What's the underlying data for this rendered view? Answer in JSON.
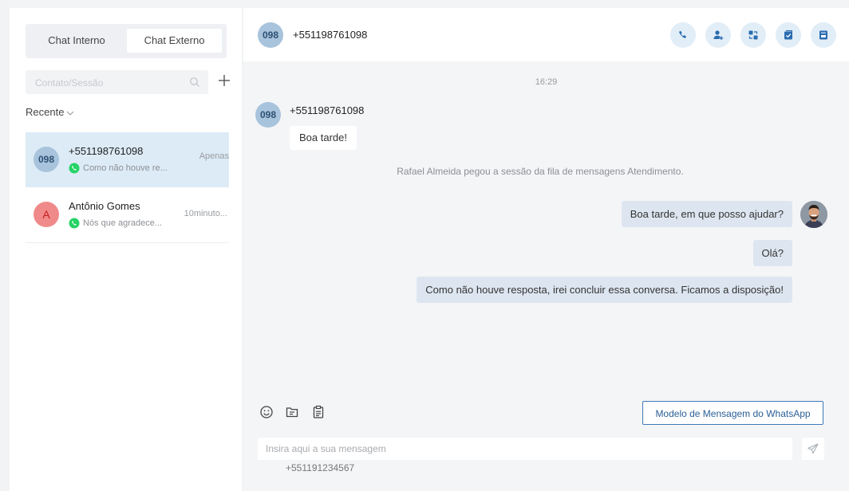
{
  "sidebar": {
    "tabs": [
      {
        "label": "Chat Interno"
      },
      {
        "label": "Chat Externo"
      }
    ],
    "search": {
      "placeholder": "Contato/Sessão"
    },
    "filter_label": "Recente",
    "conversations": [
      {
        "avatar_text": "098",
        "name": "+551198761098",
        "preview": "Como não houve re...",
        "time": "Apenas",
        "active": true
      },
      {
        "avatar_text": "A",
        "name": "Antônio Gomes",
        "preview": "Nós que agradece...",
        "time": "10minuto..."
      }
    ]
  },
  "chat": {
    "header": {
      "avatar_text": "098",
      "phone": "+551198761098"
    },
    "header_actions": [
      "phone-icon",
      "add-user-icon",
      "transfer-icon",
      "check-square-icon",
      "archive-icon"
    ],
    "timestamp": "16:29",
    "incoming": {
      "avatar_text": "098",
      "sender": "+551198761098",
      "text": "Boa tarde!"
    },
    "system_message": "Rafael Almeida pegou a sessão da fila de mensagens Atendimento.",
    "outgoing": [
      "Boa tarde, em que posso ajudar?",
      "Olá?",
      "Como não houve resposta, irei concluir essa conversa. Ficamos a disposição!"
    ],
    "toolbar": {
      "icons": [
        "emoji-icon",
        "folder-icon",
        "clipboard-icon"
      ],
      "template_button": "Modelo de Mensagem do WhatsApp"
    },
    "composer": {
      "placeholder": "Insira aqui a sua mensagem",
      "value": ""
    },
    "caller_number": "+551191234567"
  },
  "colors": {
    "accent": "#3d7ab8",
    "active_row": "#dcebf6",
    "whatsapp": "#25d366",
    "outgoing_bubble": "#dde6f0"
  }
}
